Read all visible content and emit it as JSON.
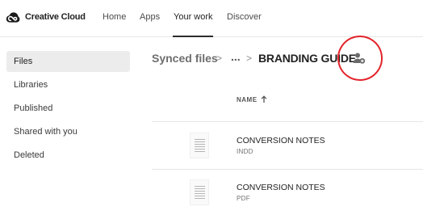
{
  "app": {
    "brand": "Creative Cloud",
    "logo_icon": "creative-cloud-logo-icon"
  },
  "nav": {
    "items": [
      {
        "label": "Home",
        "active": false
      },
      {
        "label": "Apps",
        "active": false
      },
      {
        "label": "Your work",
        "active": true
      },
      {
        "label": "Discover",
        "active": false
      }
    ]
  },
  "sidebar": {
    "items": [
      {
        "label": "Files",
        "active": true
      },
      {
        "label": "Libraries",
        "active": false
      },
      {
        "label": "Published",
        "active": false
      },
      {
        "label": "Shared with you",
        "active": false
      },
      {
        "label": "Deleted",
        "active": false
      }
    ]
  },
  "breadcrumb": {
    "root": "Synced files",
    "separator": ">",
    "ellipsis": "...",
    "current": "BRANDING GUIDE",
    "share_icon": "add-person-icon"
  },
  "table": {
    "column_name": "NAME",
    "sort_icon": "arrow-up-icon",
    "rows": [
      {
        "name": "CONVERSION NOTES",
        "type": "INDD"
      },
      {
        "name": "CONVERSION NOTES",
        "type": "PDF"
      }
    ]
  },
  "colors": {
    "annotation": "#e3242b",
    "active_bg": "#ececec",
    "text_primary": "#222222",
    "text_muted": "#6e6e6e"
  }
}
